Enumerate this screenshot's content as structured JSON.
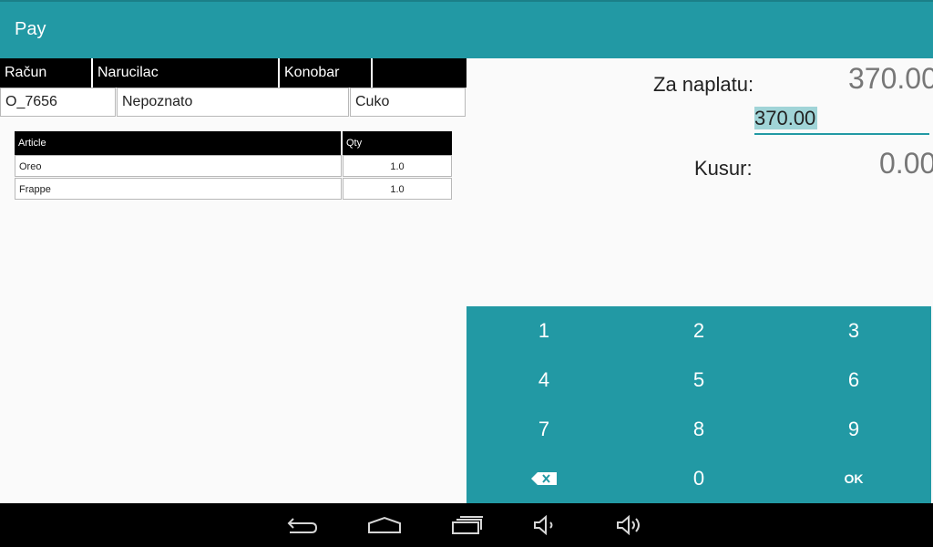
{
  "app": {
    "title": "Pay"
  },
  "order": {
    "headers": [
      "Račun",
      "Narucilac",
      "Konobar",
      ""
    ],
    "values": [
      "O_7656",
      "Nepoznato",
      "Cuko"
    ]
  },
  "articles": {
    "headers": {
      "article": "Article",
      "qty": "Qty"
    },
    "rows": [
      {
        "article": "Oreo",
        "qty": "1.0"
      },
      {
        "article": "Frappe",
        "qty": "1.0"
      }
    ]
  },
  "payment": {
    "due_label": "Za naplatu:",
    "due_value": "370.00",
    "input_value": "370.00",
    "change_label": "Kusur:",
    "change_value": "0.00"
  },
  "keypad": {
    "keys": [
      "1",
      "2",
      "3",
      "4",
      "5",
      "6",
      "7",
      "8",
      "9",
      "backspace",
      "0",
      "OK"
    ]
  },
  "navbar": {
    "icons": [
      "back-icon",
      "home-icon",
      "recents-icon",
      "volume-down-icon",
      "volume-up-icon"
    ]
  },
  "colors": {
    "accent": "#2299a4",
    "header_bg": "#000000",
    "highlight": "#a0d4d7"
  }
}
